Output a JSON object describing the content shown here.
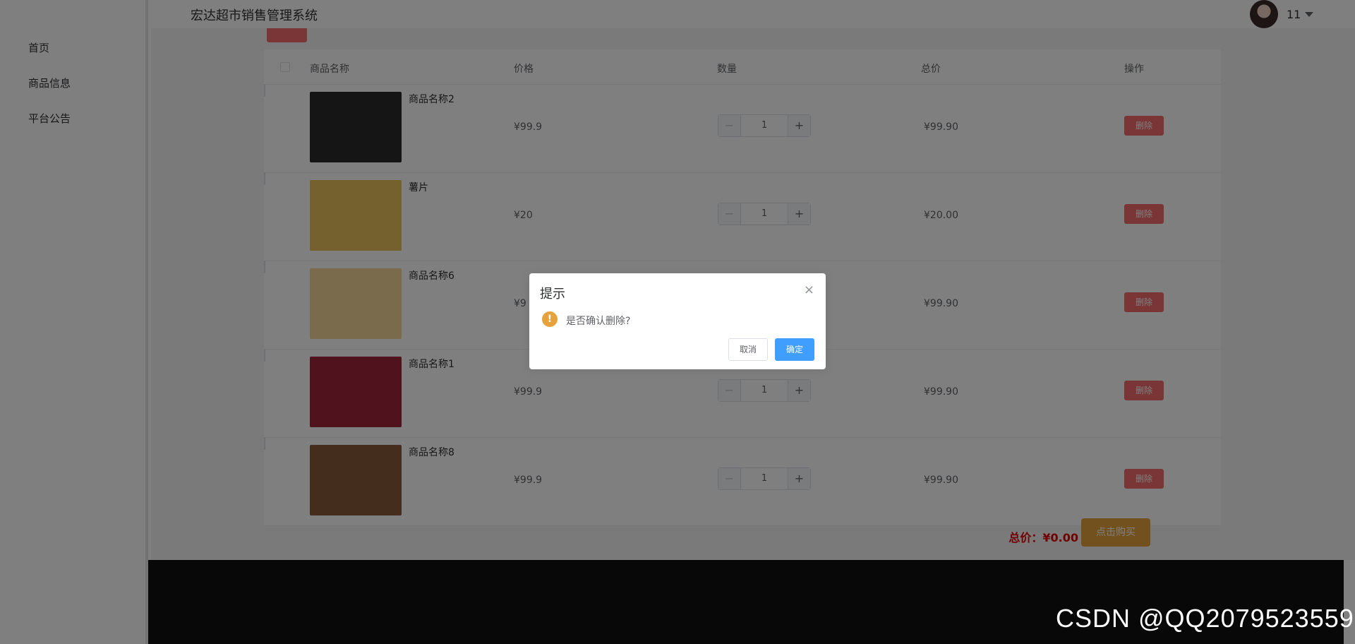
{
  "header": {
    "title": "宏达超市销售管理系统",
    "username": "11"
  },
  "sidebar": {
    "items": [
      {
        "label": "首页"
      },
      {
        "label": "商品信息"
      },
      {
        "label": "平台公告"
      }
    ]
  },
  "table": {
    "columns": [
      "商品名称",
      "价格",
      "数量",
      "总价",
      "操作"
    ],
    "rows": [
      {
        "name": "商品名称2",
        "price": "¥99.9",
        "qty": "1",
        "subtotal": "¥99.90",
        "action": "删除",
        "thumb_color": "#2b2b2b"
      },
      {
        "name": "薯片",
        "price": "¥20",
        "qty": "1",
        "subtotal": "¥20.00",
        "action": "删除",
        "thumb_color": "#e8c35a"
      },
      {
        "name": "商品名称6",
        "price": "¥9",
        "qty": "",
        "subtotal": "¥99.90",
        "action": "删除",
        "thumb_color": "#f4d79a"
      },
      {
        "name": "商品名称1",
        "price": "¥99.9",
        "qty": "1",
        "subtotal": "¥99.90",
        "action": "删除",
        "thumb_color": "#a0243a"
      },
      {
        "name": "商品名称8",
        "price": "¥99.9",
        "qty": "1",
        "subtotal": "¥99.90",
        "action": "删除",
        "thumb_color": "#8a5a3a"
      }
    ]
  },
  "total": {
    "label": "总价：",
    "amount": "¥0.00",
    "buy_label": "点击购买"
  },
  "dialog": {
    "title": "提示",
    "message": "是否确认删除?",
    "cancel_label": "取消",
    "ok_label": "确定",
    "icon": "!",
    "close_icon": "×"
  },
  "watermark": "CSDN @QQ2079523559",
  "colors": {
    "danger": "#f56c6c",
    "primary": "#409eff",
    "warning": "#e6a23c",
    "total_red": "#e00000"
  }
}
